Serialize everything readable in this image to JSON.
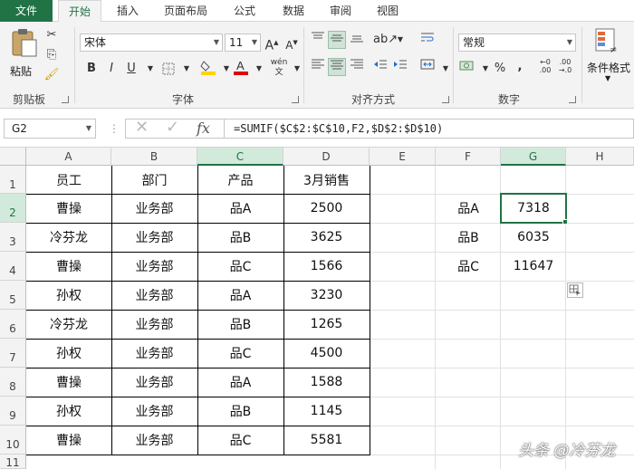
{
  "tabs": [
    "文件",
    "开始",
    "插入",
    "页面布局",
    "公式",
    "数据",
    "审阅",
    "视图"
  ],
  "ribbon": {
    "paste_label": "粘贴",
    "clipboard_label": "剪贴板",
    "font_name": "宋体",
    "font_size": "11",
    "font_label": "字体",
    "bold": "B",
    "italic": "I",
    "underline": "U",
    "align_label": "对齐方式",
    "number_format": "常规",
    "number_label": "数字",
    "percent": "%",
    "comma": ",",
    "conditional_format_label": "条件格式"
  },
  "formula_bar": {
    "name_box": "G2",
    "formula": "=SUMIF($C$2:$C$10,F2,$D$2:$D$10)"
  },
  "columns": [
    "A",
    "B",
    "C",
    "D",
    "E",
    "F",
    "G",
    "H"
  ],
  "rows": [
    "1",
    "2",
    "3",
    "4",
    "5",
    "6",
    "7",
    "8",
    "9",
    "10",
    "11"
  ],
  "table": {
    "headers": [
      "员工",
      "部门",
      "产品",
      "3月销售"
    ],
    "rows": [
      [
        "曹操",
        "业务部",
        "品A",
        "2500"
      ],
      [
        "冷芬龙",
        "业务部",
        "品B",
        "3625"
      ],
      [
        "曹操",
        "业务部",
        "品C",
        "1566"
      ],
      [
        "孙权",
        "业务部",
        "品A",
        "3230"
      ],
      [
        "冷芬龙",
        "业务部",
        "品B",
        "1265"
      ],
      [
        "孙权",
        "业务部",
        "品C",
        "4500"
      ],
      [
        "曹操",
        "业务部",
        "品A",
        "1588"
      ],
      [
        "孙权",
        "业务部",
        "品B",
        "1145"
      ],
      [
        "曹操",
        "业务部",
        "品C",
        "5581"
      ]
    ]
  },
  "summary": [
    [
      "品A",
      "7318"
    ],
    [
      "品B",
      "6035"
    ],
    [
      "品C",
      "11647"
    ]
  ],
  "watermark": "头条 @冷芬龙",
  "colors": {
    "accent": "#217346",
    "selected_header": "#d2eadb"
  }
}
